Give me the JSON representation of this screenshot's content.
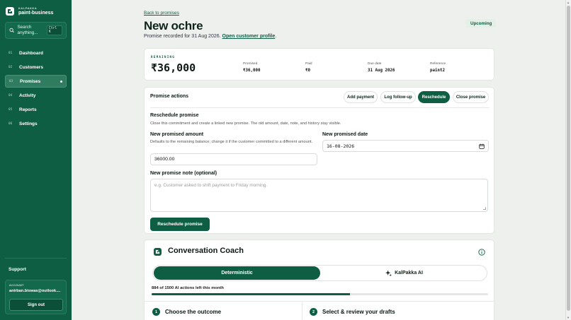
{
  "sidebar": {
    "brand_kicker": "KALPAKKA",
    "brand_name": "paint-business",
    "search_placeholder": "Search anything...",
    "search_shortcut": "Ctrl K",
    "items": [
      {
        "num": "01",
        "label": "Dashboard"
      },
      {
        "num": "02",
        "label": "Customers"
      },
      {
        "num": "03",
        "label": "Promises"
      },
      {
        "num": "04",
        "label": "Activity"
      },
      {
        "num": "05",
        "label": "Reports"
      },
      {
        "num": "06",
        "label": "Settings"
      }
    ],
    "active_item": "Promises",
    "support_label": "Support",
    "account_label": "ACCOUNT",
    "account_email": "anirban.biswas@outlook....",
    "sign_out_label": "Sign out"
  },
  "header": {
    "back_link": "Back to promises",
    "title": "New ochre",
    "subtitle_prefix": "Promise recorded for 31 Aug 2026.",
    "subtitle_link": "Open customer profile",
    "subtitle_suffix": ".",
    "status_badge": "Upcoming"
  },
  "summary": {
    "remaining_label": "REMAINING",
    "remaining_value": "₹36,000",
    "stats": [
      {
        "label": "Promised",
        "value": "₹36,000"
      },
      {
        "label": "Paid",
        "value": "₹0"
      },
      {
        "label": "Due date",
        "value": "31 Aug 2026"
      },
      {
        "label": "Reference",
        "value": "paint2"
      }
    ]
  },
  "actions": {
    "title": "Promise actions",
    "buttons": [
      "Add payment",
      "Log follow-up",
      "Reschedule",
      "Close promise"
    ],
    "active_button": "Reschedule",
    "section_title": "Reschedule promise",
    "section_help": "Close this commitment and create a linked new promise. The old amount, date, note, and history stay visible.",
    "amount_label": "New promised amount",
    "amount_help": "Defaults to the remaining balance; change it if the customer committed to a different amount.",
    "amount_value": "36000.00",
    "date_label": "New promised date",
    "date_value": "16-08-2026",
    "note_label": "New promise note (optional)",
    "note_placeholder": "e.g. Customer asked to shift payment to Friday morning.",
    "submit_label": "Reschedule promise"
  },
  "coach": {
    "title": "Conversation Coach",
    "mode_options": [
      "Deterministic",
      "KalPakka AI"
    ],
    "selected_mode": "Deterministic",
    "quota_text": "884 of 1500 AI actions left this month",
    "quota_fraction": 0.589,
    "steps": [
      {
        "num": "1",
        "label": "Choose the outcome"
      },
      {
        "num": "2",
        "label": "Select & review your drafts"
      }
    ]
  },
  "colors": {
    "brand": "#0e5e43",
    "background": "#eef0ee"
  }
}
